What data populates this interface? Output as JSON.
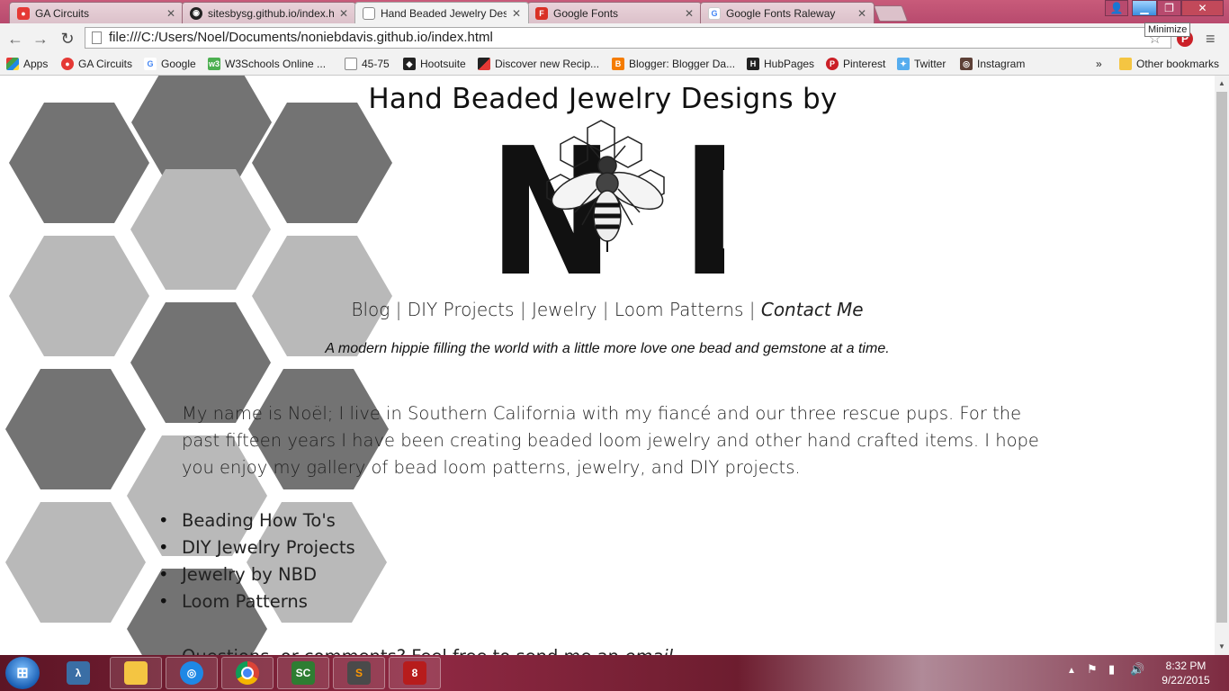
{
  "browser": {
    "tabs": [
      {
        "title": "GA Circuits",
        "icon": "ga-circuits-icon",
        "active": false
      },
      {
        "title": "sitesbysg.github.io/index.h",
        "icon": "github-icon",
        "active": false
      },
      {
        "title": "Hand Beaded Jewelry Des",
        "icon": "page-icon",
        "active": true
      },
      {
        "title": "Google Fonts",
        "icon": "google-fonts-icon",
        "active": false
      },
      {
        "title": "Google Fonts Raleway",
        "icon": "google-icon",
        "active": false
      }
    ],
    "address": "file:///C:/Users/Noel/Documents/noniebdavis.github.io/index.html",
    "tooltip": "Minimize",
    "bookmarks": [
      {
        "label": "Apps",
        "icon": "apps-grid-icon"
      },
      {
        "label": "GA Circuits",
        "icon": "ga-circuits-icon"
      },
      {
        "label": "Google",
        "icon": "google-icon"
      },
      {
        "label": "W3Schools Online ...",
        "icon": "w3schools-icon"
      },
      {
        "label": "45-75",
        "icon": "page-icon"
      },
      {
        "label": "Hootsuite",
        "icon": "hootsuite-icon"
      },
      {
        "label": "Discover new Recip...",
        "icon": "recipe-icon"
      },
      {
        "label": "Blogger: Blogger Da...",
        "icon": "blogger-icon"
      },
      {
        "label": "HubPages",
        "icon": "hubpages-icon"
      },
      {
        "label": "Pinterest",
        "icon": "pinterest-icon"
      },
      {
        "label": "Twitter",
        "icon": "twitter-icon"
      },
      {
        "label": "Instagram",
        "icon": "instagram-icon"
      }
    ],
    "overflow": "»",
    "other_bookmarks": "Other bookmarks"
  },
  "page": {
    "title": "Hand Beaded Jewelry Designs by",
    "logo_letters": {
      "left": "N",
      "right": "D"
    },
    "nav": {
      "blog": "Blog",
      "diy": "DIY Projects",
      "jewelry": "Jewelry",
      "loom": "Loom Patterns",
      "contact": "Contact Me",
      "separator": "|"
    },
    "tagline": "A modern hippie filling the world with a little more love one bead and gemstone at a time.",
    "intro": "My name is Noël; I live in Southern California with my fiancé and our three rescue pups. For the past fifteen years I have been creating beaded loom jewelry and other hand crafted items. I hope you enjoy my gallery of bead loom patterns, jewelry, and DIY projects.",
    "links": [
      "Beading How To's",
      "DIY Jewelry Projects",
      "Jewelry by NBD",
      "Loom Patterns"
    ],
    "footer": {
      "text": "Questions, or comments? Feel free to send me an ",
      "email": "email"
    }
  },
  "taskbar": {
    "apps": [
      "powershell-icon",
      "file-explorer-icon",
      "network-icon",
      "chrome-icon",
      "sc-app-icon",
      "sublime-text-icon",
      "paint-shop-pro-icon"
    ],
    "sc_label": "SC",
    "psp_label": "8",
    "time": "8:32 PM",
    "date": "9/22/2015"
  },
  "colors": {
    "hex_dark": "#737373",
    "hex_light": "#b9b9b9",
    "tab_strip": "#c85b7a"
  }
}
